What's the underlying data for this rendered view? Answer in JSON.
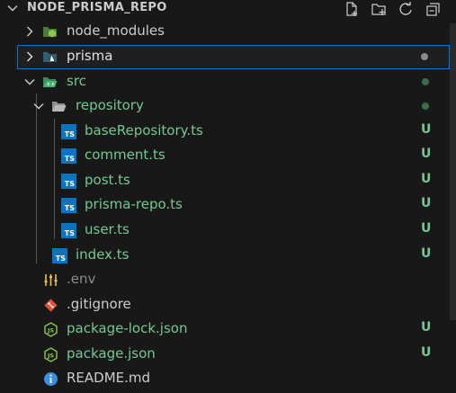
{
  "explorer": {
    "title": "NODE_PRISMA_REPO",
    "header_actions": [
      "new-file-icon",
      "new-folder-icon",
      "refresh-icon",
      "collapse-all-icon"
    ]
  },
  "tree": {
    "node_modules": {
      "label": "node_modules",
      "color": "#8c8c8c"
    },
    "prisma": {
      "label": "prisma",
      "color": "#e0e0e0",
      "status_dot": "#8b8b8b"
    },
    "src": {
      "label": "src",
      "color": "#73c991",
      "status_dot": "#3b6b4a"
    },
    "repository": {
      "label": "repository",
      "color": "#73c991",
      "status_dot": "#3b6b4a"
    },
    "baseRepository": {
      "label": "baseRepository.ts",
      "badge": "U"
    },
    "comment": {
      "label": "comment.ts",
      "badge": "U"
    },
    "post": {
      "label": "post.ts",
      "badge": "U"
    },
    "prisma_repo": {
      "label": "prisma-repo.ts",
      "badge": "U"
    },
    "user": {
      "label": "user.ts",
      "badge": "U"
    },
    "index": {
      "label": "index.ts",
      "badge": "U"
    },
    "env": {
      "label": ".env",
      "color": "#8c8c8c"
    },
    "gitignore": {
      "label": ".gitignore",
      "color": "#cccccc"
    },
    "package_lock": {
      "label": "package-lock.json",
      "badge": "U"
    },
    "package_json": {
      "label": "package.json",
      "badge": "U"
    },
    "readme": {
      "label": "README.md",
      "color": "#cccccc"
    }
  },
  "colors": {
    "untracked": "#73c991",
    "ts_icon": "#0a74c0",
    "json_icon": "#cbcb41",
    "selection_border": "#0078d4"
  }
}
